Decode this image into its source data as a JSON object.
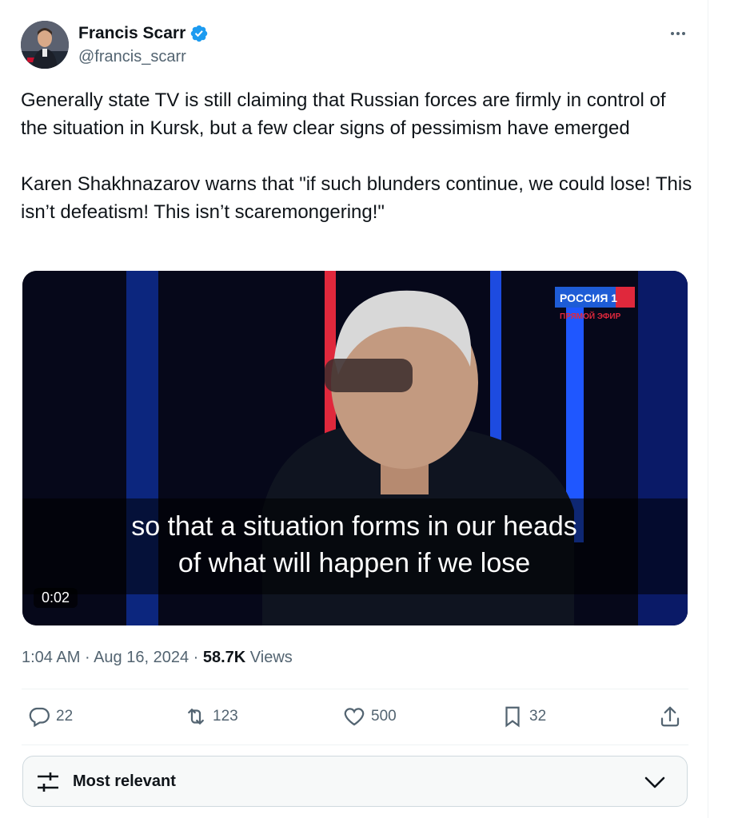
{
  "author": {
    "name": "Francis Scarr",
    "handle": "@francis_scarr",
    "verified_color": "#1d9bf0"
  },
  "tweet": {
    "text": "Generally state TV is still claiming that Russian forces are firmly in control of the situation in Kursk, but a few clear signs of pessimism have emerged\n\nKaren Shakhnazarov warns that \"if such blunders continue, we could lose! This isn’t defeatism! This isn’t scaremongering!\""
  },
  "video": {
    "subtitle_line1": "so that a situation forms in our heads",
    "subtitle_line2": "of what will happen if we lose",
    "timestamp": "0:02",
    "channel_logo": "РОССИЯ 1",
    "channel_sub": "ПРЯМОЙ ЭФИР"
  },
  "meta": {
    "time": "1:04 AM",
    "date": "Aug 16, 2024",
    "views_count": "58.7K",
    "views_label": "Views"
  },
  "actions": {
    "replies": "22",
    "reposts": "123",
    "likes": "500",
    "bookmarks": "32"
  },
  "replies_filter": {
    "label": "Most relevant"
  }
}
